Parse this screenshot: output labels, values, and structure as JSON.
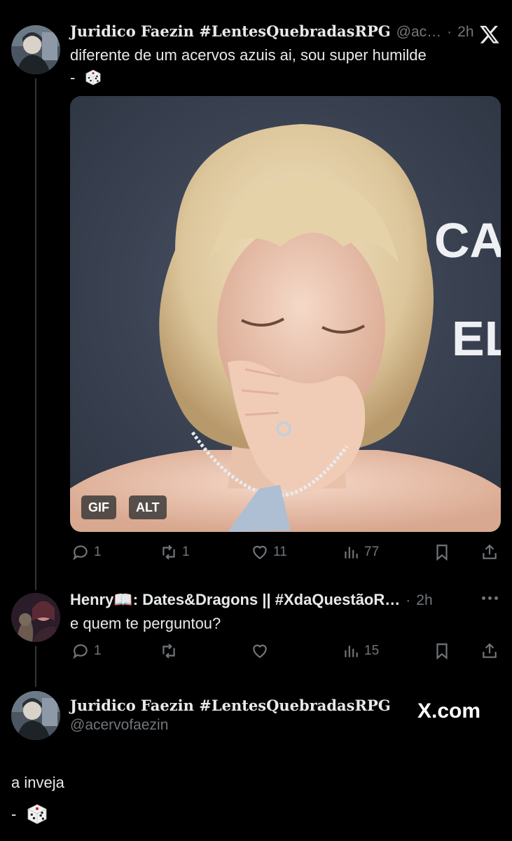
{
  "post1": {
    "display_name": "Juridico Faezin #LentesQuebradasRPG",
    "handle_truncated": "@ac…",
    "sep": "·",
    "time": "2h",
    "text_line1": "diferente de um acervos azuis ai, sou super humilde",
    "text_line2": "-",
    "media": {
      "badge_gif": "GIF",
      "badge_alt": "ALT",
      "sign_line1": "CAR",
      "sign_line2": "EL"
    },
    "actions": {
      "reply": "1",
      "repost": "1",
      "like": "11",
      "views": "77"
    }
  },
  "post2": {
    "display_name": "Henry📖: Dates&Dragons || #XdaQuestãoR…",
    "sep": "·",
    "time": "2h",
    "text": "e quem te perguntou?",
    "actions": {
      "reply": "1",
      "repost": "",
      "like": "",
      "views": "15"
    }
  },
  "post3": {
    "display_name": "Juridico Faezin #LentesQuebradasRPG",
    "handle": "@acervofaezin",
    "text_line1": "a inveja",
    "text_line2": "-"
  },
  "brand": {
    "watermark": "X.com"
  },
  "icons": {
    "reply": "reply-icon",
    "repost": "repost-icon",
    "like": "heart-icon",
    "views": "views-icon",
    "bookmark": "bookmark-icon",
    "share": "share-icon",
    "more": "more-icon",
    "close": "x-logo-icon",
    "dice": "dice-emoji"
  },
  "colors": {
    "background": "#000000",
    "text": "#e7e9ea",
    "muted": "#71767b",
    "thread_line": "#333639"
  }
}
